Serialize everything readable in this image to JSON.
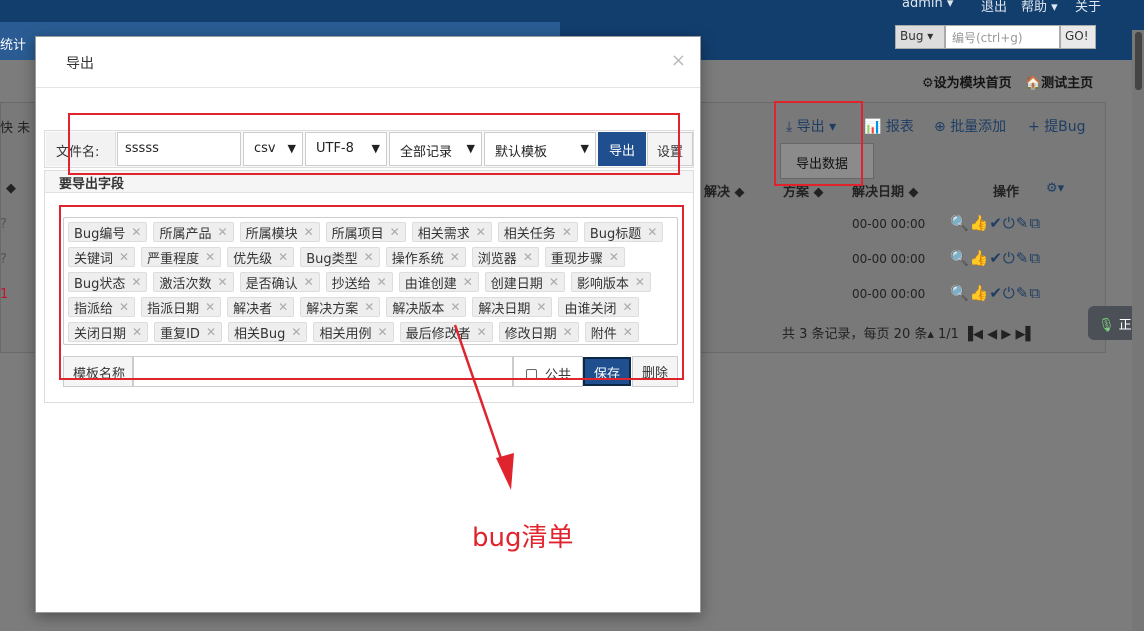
{
  "header": {
    "user": "admin ▾",
    "logout": "退出",
    "help": "帮助 ▾",
    "about": "关于",
    "nav_stats": "统计",
    "search_type": "Bug ▾",
    "search_placeholder": "编号(ctrl+g)",
    "search_go": "GO!"
  },
  "page": {
    "link_module_home": "⚙设为模块首页",
    "link_test_home": "🏠测试主页",
    "left_fragment": "快  未",
    "toolbar": {
      "export": "导出",
      "report": "报表",
      "batch_add": "批量添加",
      "add_bug": "提Bug"
    },
    "export_menu_item": "导出数据",
    "columns": {
      "resolve": "解决 ◆",
      "solution": "方案 ◆",
      "resolve_date": "解决日期 ◆",
      "actions": "操作",
      "settings": "⚙▾"
    },
    "rows": [
      {
        "date": "00-00 00:00"
      },
      {
        "date": "00-00 00:00"
      },
      {
        "date": "00-00 00:00"
      }
    ],
    "pager": "共 3 条记录，每页 20 条▴   1/1   ▐◀   ◀   ▶   ▶▌",
    "side_bubble": "正"
  },
  "modal": {
    "title": "导出",
    "close": "×",
    "filename_label": "文件名:",
    "filename_value": "sssss",
    "format": "csv",
    "encoding": "UTF-8",
    "range": "全部记录",
    "template": "默认模板",
    "export_button": "导出",
    "settings_button": "设置",
    "fields_heading": "要导出字段",
    "fields": [
      "Bug编号",
      "所属产品",
      "所属模块",
      "所属项目",
      "相关需求",
      "相关任务",
      "Bug标题",
      "关键词",
      "严重程度",
      "优先级",
      "Bug类型",
      "操作系统",
      "浏览器",
      "重现步骤",
      "Bug状态",
      "激活次数",
      "是否确认",
      "抄送给",
      "由谁创建",
      "创建日期",
      "影响版本",
      "指派给",
      "指派日期",
      "解决者",
      "解决方案",
      "解决版本",
      "解决日期",
      "由谁关闭",
      "关闭日期",
      "重复ID",
      "相关Bug",
      "相关用例",
      "最后修改者",
      "修改日期",
      "附件"
    ],
    "template_name_label": "模板名称",
    "public_label": "公共",
    "save_button": "保存",
    "delete_button": "删除"
  },
  "annotation": {
    "text": "bug清单",
    "color": "#e0242e"
  }
}
